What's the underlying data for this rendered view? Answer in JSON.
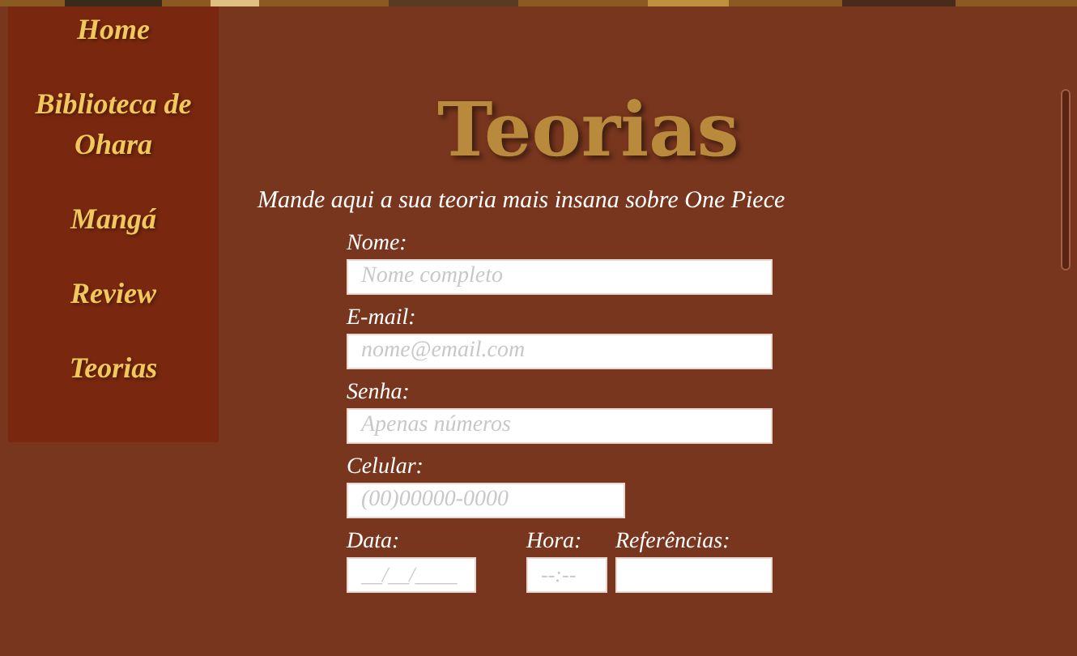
{
  "nav": {
    "items": [
      {
        "label": "Home"
      },
      {
        "label": "Biblioteca de Ohara"
      },
      {
        "label": "Mangá"
      },
      {
        "label": "Review"
      },
      {
        "label": "Teorias"
      }
    ]
  },
  "title": "Teorias",
  "intro": "Mande aqui a sua teoria mais insana sobre One Piece",
  "form": {
    "fields": [
      {
        "label": "Nome:",
        "placeholder": "Nome completo"
      },
      {
        "label": "E-mail:",
        "placeholder": "nome@email.com"
      },
      {
        "label": "Senha:",
        "placeholder": "Apenas números"
      },
      {
        "label": "Celular:",
        "placeholder": "(00)00000-0000"
      }
    ],
    "row": [
      {
        "label": "Data:",
        "placeholder": "__/__/____"
      },
      {
        "label": "Hora:",
        "placeholder": "--:--"
      },
      {
        "label": "Referências:"
      }
    ]
  }
}
